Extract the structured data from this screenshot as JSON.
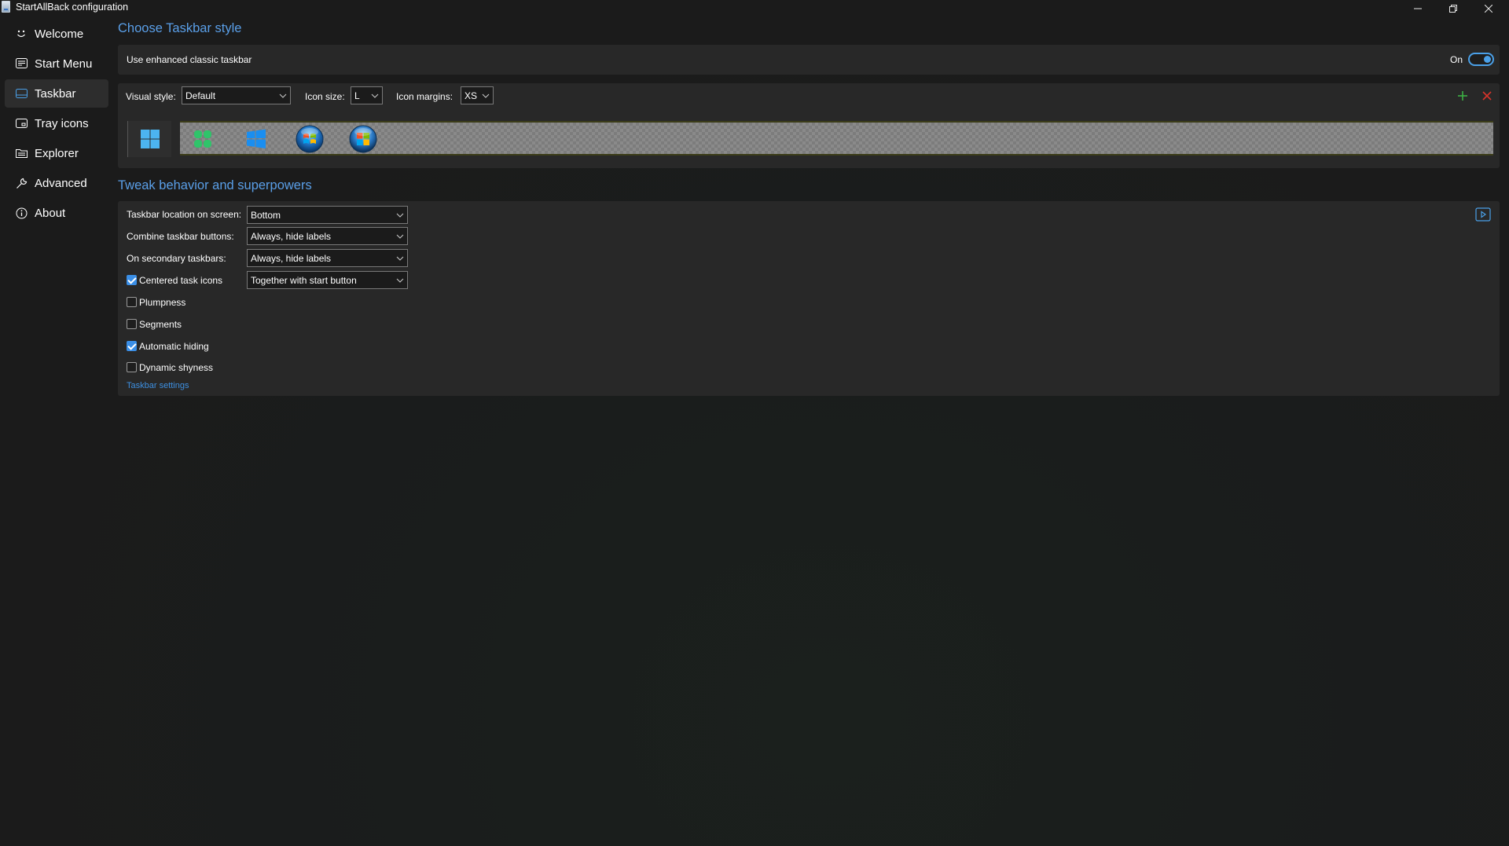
{
  "window": {
    "title": "StartAllBack configuration"
  },
  "sidebar": {
    "items": [
      {
        "label": "Welcome",
        "icon": "smile-icon"
      },
      {
        "label": "Start Menu",
        "icon": "start-menu-icon"
      },
      {
        "label": "Taskbar",
        "icon": "taskbar-icon",
        "active": true
      },
      {
        "label": "Tray icons",
        "icon": "tray-icon"
      },
      {
        "label": "Explorer",
        "icon": "explorer-icon"
      },
      {
        "label": "Advanced",
        "icon": "wrench-icon"
      },
      {
        "label": "About",
        "icon": "info-icon"
      }
    ]
  },
  "taskbar_style": {
    "section_title": "Choose Taskbar style",
    "enhanced_label": "Use enhanced classic taskbar",
    "enhanced_state": "On",
    "visual_style_label": "Visual style:",
    "visual_style_value": "Default",
    "icon_size_label": "Icon size:",
    "icon_size_value": "L",
    "icon_margins_label": "Icon margins:",
    "icon_margins_value": "XS",
    "style_options": [
      "windows11-logo",
      "clover-logo",
      "windows10-logo",
      "windows7-orb",
      "vista-orb"
    ],
    "selected_option": 0
  },
  "tweaks": {
    "section_title": "Tweak behavior and superpowers",
    "location_label": "Taskbar location on screen:",
    "location_value": "Bottom",
    "combine_label": "Combine taskbar buttons:",
    "combine_value": "Always, hide labels",
    "secondary_label": "On secondary taskbars:",
    "secondary_value": "Always, hide labels",
    "centered_label": "Centered task icons",
    "centered_checked": true,
    "centered_value": "Together with start button",
    "plumpness_label": "Plumpness",
    "plumpness_checked": false,
    "segments_label": "Segments",
    "segments_checked": false,
    "autohide_label": "Automatic hiding",
    "autohide_checked": true,
    "shyness_label": "Dynamic shyness",
    "shyness_checked": false,
    "settings_link": "Taskbar settings"
  },
  "colors": {
    "accent": "#4aa0e8",
    "section_title": "#5a9fe8",
    "add": "#3cb043",
    "remove": "#d9342b"
  }
}
